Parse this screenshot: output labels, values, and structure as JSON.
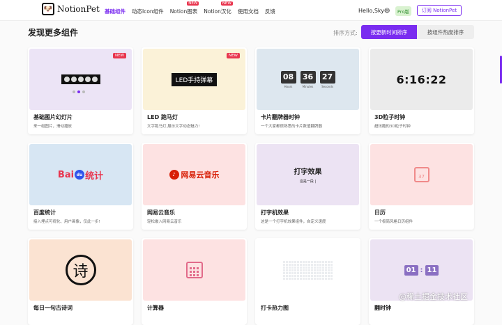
{
  "header": {
    "logo_icon": "dog-face-icon",
    "logo_text": "NotionPet",
    "nav": [
      {
        "label": "基础组件",
        "active": true,
        "new": ""
      },
      {
        "label": "动态Icon组件",
        "active": false,
        "new": ""
      },
      {
        "label": "Notion图表",
        "active": false,
        "new": "NEW"
      },
      {
        "label": "Notion汉化",
        "active": false,
        "new": "NEW"
      },
      {
        "label": "使用文档",
        "active": false,
        "new": ""
      },
      {
        "label": "反馈",
        "active": false,
        "new": ""
      }
    ],
    "user_greeting": "Hello,Sky😄",
    "pro_badge": "Pro版",
    "subscribe_label": "订阅 NotionPet"
  },
  "main": {
    "title": "发现更多组件",
    "sort_label": "排序方式:",
    "sort_options": [
      "按更新时间排序",
      "按组件热度排序"
    ]
  },
  "cards": [
    {
      "title": "基础图片幻灯片",
      "desc": "来一组图片，滑动播放",
      "tag": "NEW"
    },
    {
      "title": "LED 跑马灯",
      "desc": "文字跑马灯,展示文字动态魅力!",
      "tag": "NEW",
      "preview_text": "LED手持弹幕"
    },
    {
      "title": "卡片翻牌器时钟",
      "desc": "一个大家都很熟悉的卡片数值翻牌器",
      "tag": "",
      "digits": [
        "08",
        "36",
        "27"
      ],
      "digit_labels": [
        "Hours",
        "Minutes",
        "Seconds"
      ]
    },
    {
      "title": "3D粒子时钟",
      "desc": "超炫酷的3D粒子时钟",
      "tag": "",
      "preview_text": "6:16:22"
    },
    {
      "title": "百度统计",
      "desc": "接入埋点可视化、用户画像，仅此一步!",
      "tag": "",
      "preview_text": "Bai",
      "preview_paw": "du",
      "preview_suffix": "统计"
    },
    {
      "title": "网易云音乐",
      "desc": "轻松嵌入网易云音乐",
      "tag": "",
      "preview_text": "网易云音乐"
    },
    {
      "title": "打字机效果",
      "desc": "这是一个打字机效果组件，自定义速度",
      "tag": "",
      "preview_title": "打字效果",
      "preview_sub": "这是一段 |"
    },
    {
      "title": "日历",
      "desc": "一个极简风格日历组件",
      "tag": "",
      "preview_text": "37"
    },
    {
      "title": "每日一句古诗词",
      "desc": "",
      "tag": "",
      "preview_text": "诗"
    },
    {
      "title": "计算器",
      "desc": "",
      "tag": "",
      "preview_text": ""
    },
    {
      "title": "打卡热力图",
      "desc": "",
      "tag": "",
      "preview_text": ""
    },
    {
      "title": "翻时钟",
      "desc": "",
      "tag": "",
      "digits": [
        "01",
        "11"
      ]
    }
  ],
  "watermark": "@稀土掘金技术社区",
  "colors": {
    "accent": "#7a2cf0",
    "new_badge": "#e8344d"
  }
}
